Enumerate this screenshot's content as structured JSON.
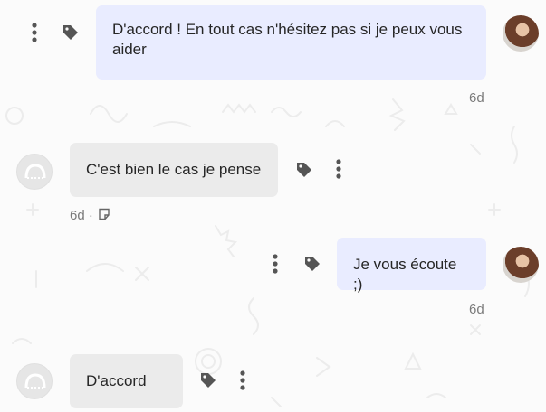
{
  "messages": [
    {
      "direction": "outgoing",
      "text": "D'accord ! En tout cas n'hésitez pas si je peux vous aider",
      "timestamp": "6d"
    },
    {
      "direction": "incoming",
      "text": "C'est bien le cas je pense",
      "timestamp": "6d ·"
    },
    {
      "direction": "outgoing",
      "text": "Je vous écoute ;)",
      "timestamp": "6d"
    },
    {
      "direction": "incoming",
      "text": "D'accord",
      "timestamp": ""
    }
  ],
  "icons": {
    "more": "more-vert-icon",
    "tag": "tag-icon",
    "note": "note-icon",
    "user_avatar": "avatar",
    "bot_avatar": "bot-avatar"
  },
  "colors": {
    "outgoing_bubble": "#e9ecff",
    "incoming_bubble": "#ebebeb",
    "icon": "#555555",
    "timestamp": "#7a7a7a"
  }
}
